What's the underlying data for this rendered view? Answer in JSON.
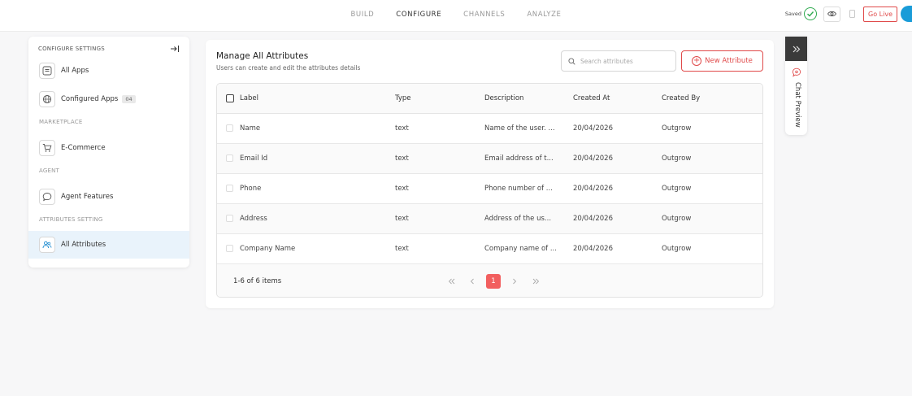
{
  "topnav": {
    "tabs": [
      {
        "label": "BUILD",
        "active": false
      },
      {
        "label": "CONFIGURE",
        "active": true
      },
      {
        "label": "CHANNELS",
        "active": false
      },
      {
        "label": "ANALYZE",
        "active": false
      }
    ],
    "saved_label": "Saved",
    "go_live_label": "Go Live",
    "icons": [
      "check-circle-icon",
      "eye-icon",
      "mobile-icon"
    ]
  },
  "sidebar": {
    "header": "CONFIGURE SETTINGS",
    "items": [
      {
        "label": "All Apps",
        "icon": "apps-icon"
      },
      {
        "label": "Configured Apps",
        "icon": "globe-icon",
        "badge": "04"
      },
      {
        "label": "E-Commerce",
        "icon": "cart-icon"
      },
      {
        "label": "Agent Features",
        "icon": "chat-bubble-icon"
      },
      {
        "label": "All Attributes",
        "icon": "users-icon",
        "active": true
      }
    ],
    "sections": [
      "MARKETPLACE",
      "AGENT",
      "ATTRIBUTES SETTING"
    ]
  },
  "main": {
    "title": "Manage All Attributes",
    "subtitle": "Users can create and edit the attributes details",
    "search_placeholder": "Search attributes",
    "new_button_label": "New Attribute",
    "columns": [
      "Label",
      "Type",
      "Description",
      "Created At",
      "Created By"
    ],
    "rows": [
      {
        "label": "Name",
        "type": "text",
        "description": "Name of the user. ...",
        "created_at": "20/04/2026",
        "created_by": "Outgrow"
      },
      {
        "label": "Email Id",
        "type": "text",
        "description": "Email address of t...",
        "created_at": "20/04/2026",
        "created_by": "Outgrow"
      },
      {
        "label": "Phone",
        "type": "text",
        "description": "Phone number of ...",
        "created_at": "20/04/2026",
        "created_by": "Outgrow"
      },
      {
        "label": "Address",
        "type": "text",
        "description": "Address of the us...",
        "created_at": "20/04/2026",
        "created_by": "Outgrow"
      },
      {
        "label": "Company Name",
        "type": "text",
        "description": "Company name of ...",
        "created_at": "20/04/2026",
        "created_by": "Outgrow"
      }
    ],
    "pagination": {
      "summary": "1-6 of 6 items",
      "current_page": "1"
    }
  },
  "chat_preview": {
    "label": "Chat Preview"
  },
  "colors": {
    "accent": "#e04a4a",
    "active_page": "#f25f5f",
    "active_sidebar": "#e9f3fb",
    "saved_green": "#2eaa4e"
  }
}
